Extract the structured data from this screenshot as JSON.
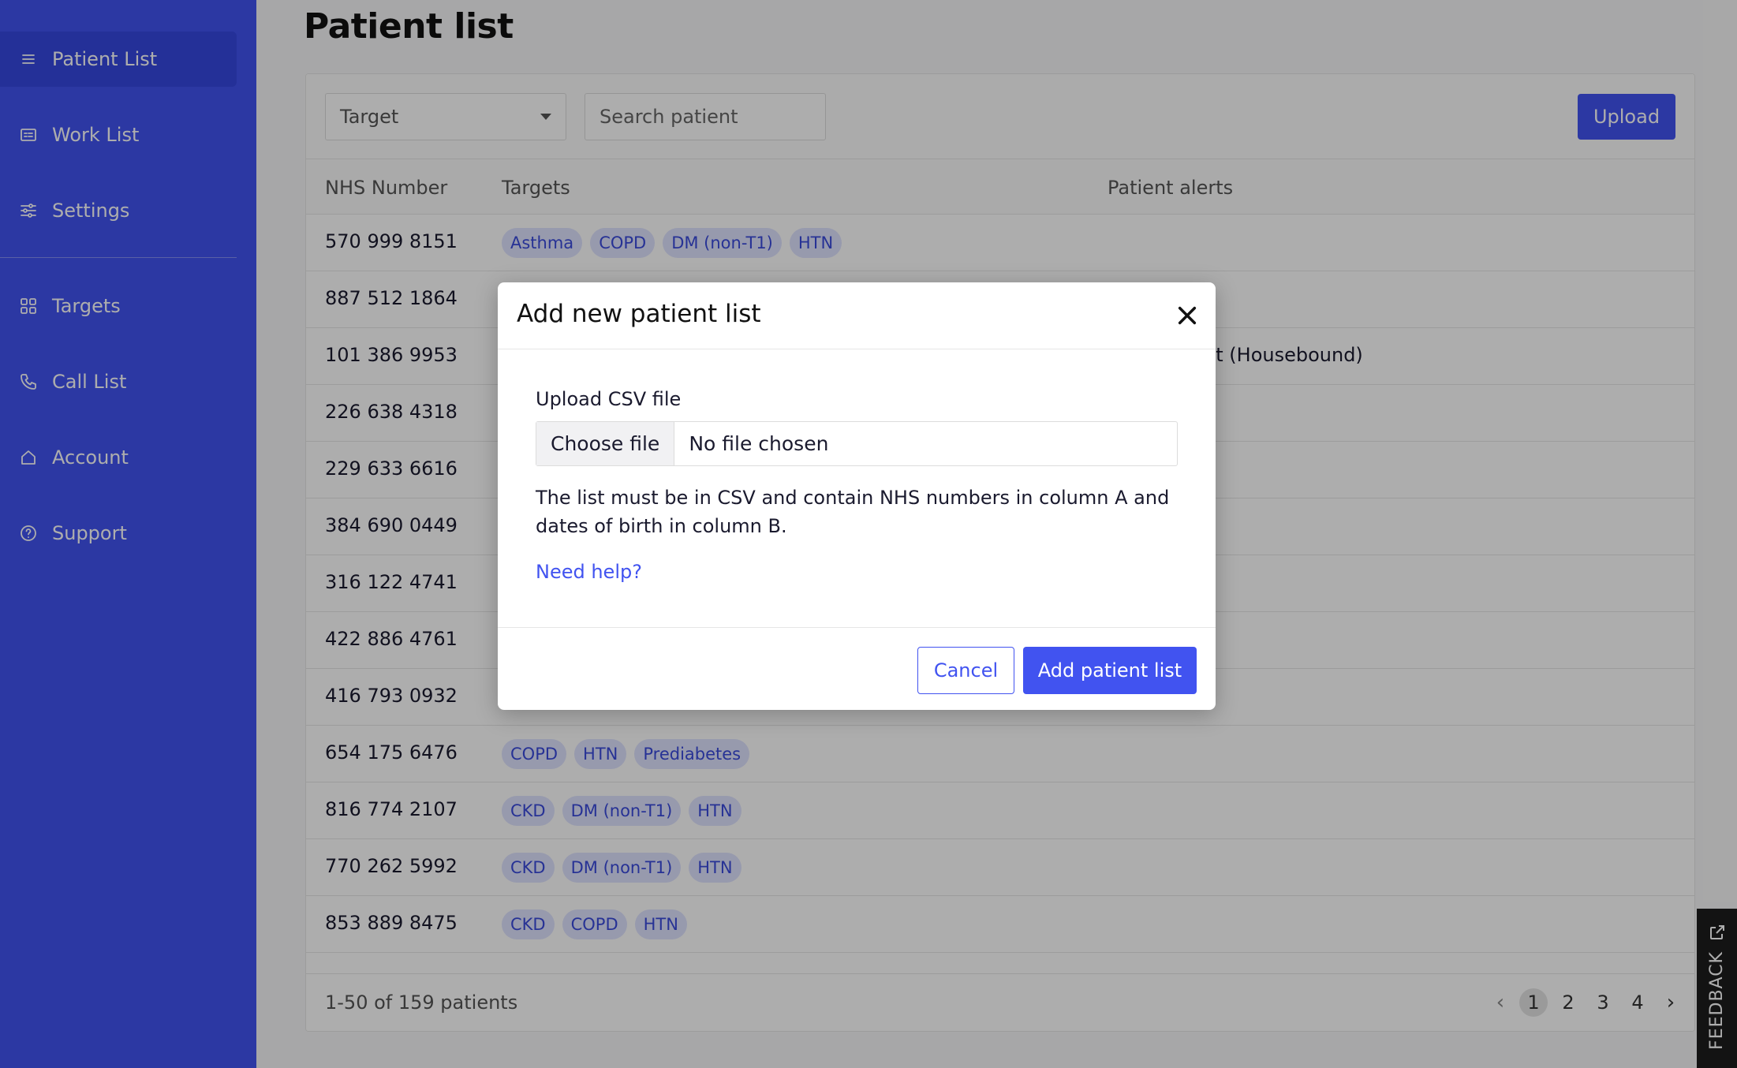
{
  "sidebar": {
    "items": [
      {
        "label": "Patient List",
        "icon": "list-icon"
      },
      {
        "label": "Work List",
        "icon": "worklist-icon"
      },
      {
        "label": "Settings",
        "icon": "sliders-icon"
      },
      {
        "label": "Targets",
        "icon": "grid-icon"
      },
      {
        "label": "Call List",
        "icon": "phone-icon"
      },
      {
        "label": "Account",
        "icon": "home-icon"
      },
      {
        "label": "Support",
        "icon": "help-circle-icon"
      }
    ],
    "active": "Patient List"
  },
  "page": {
    "title": "Patient list"
  },
  "toolbar": {
    "target_select": "Target",
    "search_placeholder": "Search patient",
    "upload_label": "Upload"
  },
  "table": {
    "headers": [
      "NHS Number",
      "Targets",
      "Patient alerts"
    ],
    "rows": [
      {
        "nhs": "570 999 8151",
        "tags": [
          "Asthma",
          "COPD",
          "DM (non-T1)",
          "HTN"
        ],
        "alert": ""
      },
      {
        "nhs": "887 512 1864",
        "tags": [],
        "alert": ""
      },
      {
        "nhs": "101 386 9953",
        "tags": [],
        "alert": "om work list (Housebound)"
      },
      {
        "nhs": "226 638 4318",
        "tags": [],
        "alert": ""
      },
      {
        "nhs": "229 633 6616",
        "tags": [],
        "alert": ""
      },
      {
        "nhs": "384 690 0449",
        "tags": [],
        "alert": ""
      },
      {
        "nhs": "316 122 4741",
        "tags": [],
        "alert": ""
      },
      {
        "nhs": "422 886 4761",
        "tags": [],
        "alert": ""
      },
      {
        "nhs": "416 793 0932",
        "tags": [],
        "alert": ""
      },
      {
        "nhs": "654 175 6476",
        "tags": [
          "COPD",
          "HTN",
          "Prediabetes"
        ],
        "alert": ""
      },
      {
        "nhs": "816 774 2107",
        "tags": [
          "CKD",
          "DM (non-T1)",
          "HTN"
        ],
        "alert": ""
      },
      {
        "nhs": "770 262 5992",
        "tags": [
          "CKD",
          "DM (non-T1)",
          "HTN"
        ],
        "alert": ""
      },
      {
        "nhs": "853 889 8475",
        "tags": [
          "CKD",
          "COPD",
          "HTN"
        ],
        "alert": ""
      }
    ]
  },
  "footer": {
    "count": "1-50 of 159 patients",
    "pages": [
      "1",
      "2",
      "3",
      "4"
    ],
    "current_page": "1"
  },
  "feedback": {
    "label": "FEEDBACK"
  },
  "modal": {
    "title": "Add new patient list",
    "upload_label": "Upload CSV file",
    "choose_file": "Choose file",
    "no_file": "No file chosen",
    "instructions": "The list must be in CSV and contain NHS numbers in column A and dates of birth in column B.",
    "help_link": "Need help?",
    "cancel_label": "Cancel",
    "add_label": "Add patient list"
  },
  "colors": {
    "accent": "#4153f0",
    "tag_bg": "#dfe3ff",
    "tag_text": "#3a4bdc"
  }
}
